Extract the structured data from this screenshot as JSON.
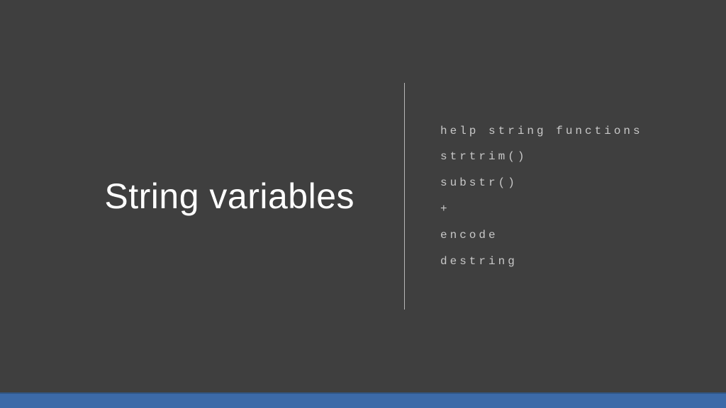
{
  "slide": {
    "title": "String variables",
    "items": [
      "help string functions",
      "strtrim()",
      "substr()",
      "+",
      "encode",
      "destring"
    ]
  }
}
